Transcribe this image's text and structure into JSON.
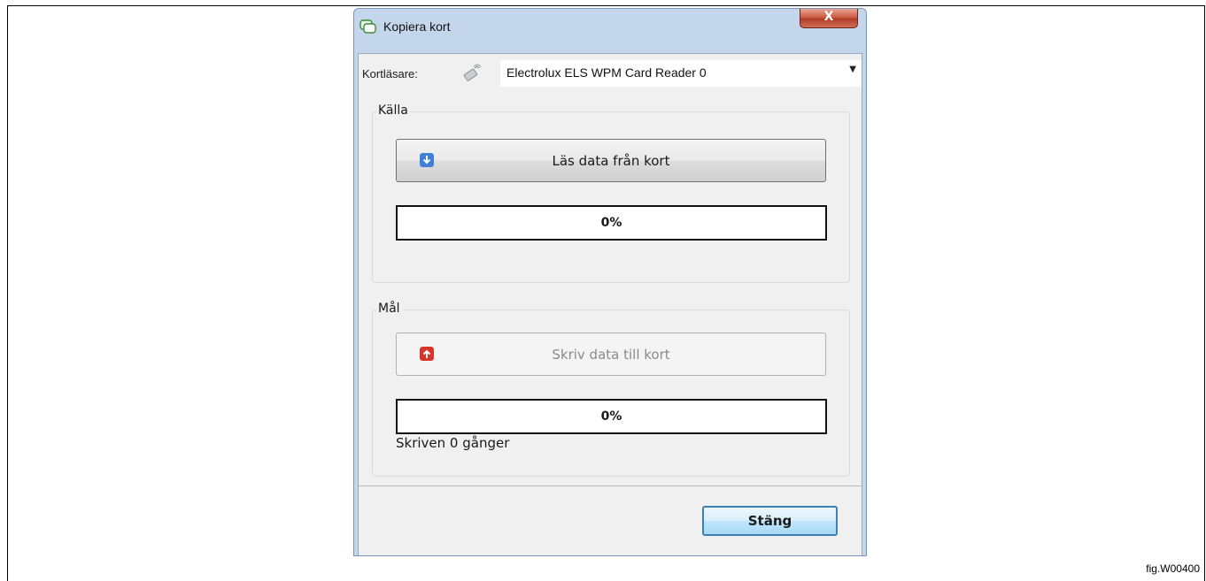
{
  "figure": {
    "label": "fig.W00400"
  },
  "window": {
    "title": "Kopiera kort",
    "close_glyph": "X"
  },
  "reader": {
    "label": "Kortläsare:",
    "selected": "Electrolux ELS WPM Card Reader 0",
    "icon": "card-reader-icon"
  },
  "source": {
    "title": "Källa",
    "button_label": "Läs data från kort",
    "button_icon": "arrow-down-icon",
    "progress_text": "0%",
    "progress_value": 0
  },
  "target": {
    "title": "Mål",
    "button_label": "Skriv data till kort",
    "button_icon": "arrow-up-icon",
    "progress_text": "0%",
    "progress_value": 0,
    "written_text": "Skriven 0 gånger"
  },
  "footer": {
    "close_button": "Stäng"
  },
  "colors": {
    "read_icon": "#3f7fd8",
    "write_icon": "#d8352a",
    "default_button_border": "#3c7fb1"
  }
}
